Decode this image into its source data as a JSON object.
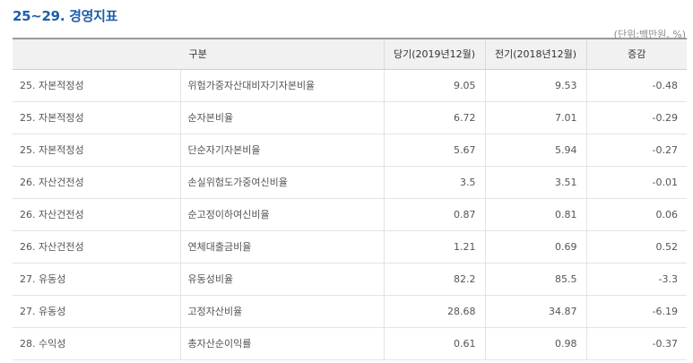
{
  "title": "25~29. 경영지표",
  "unit_note": "(단위:백만원, %)",
  "headers": [
    "구분",
    "당기(2019년12월)",
    "전기(2018년12월)",
    "증감"
  ],
  "rows": [
    {
      "category": "25. 자본적정성",
      "item": "위험가중자산대비자기자본비율",
      "current": "9.05",
      "previous": "9.53",
      "change": "-0.48"
    },
    {
      "category": "25. 자본적정성",
      "item": "순자본비율",
      "current": "6.72",
      "previous": "7.01",
      "change": "-0.29"
    },
    {
      "category": "25. 자본적정성",
      "item": "단순자기자본비율",
      "current": "5.67",
      "previous": "5.94",
      "change": "-0.27"
    },
    {
      "category": "26. 자산건전성",
      "item": "손실위험도가중여신비율",
      "current": "3.5",
      "previous": "3.51",
      "change": "-0.01"
    },
    {
      "category": "26. 자산건전성",
      "item": "순고정이하여신비율",
      "current": "0.87",
      "previous": "0.81",
      "change": "0.06"
    },
    {
      "category": "26. 자산건전성",
      "item": "연체대출금비율",
      "current": "1.21",
      "previous": "0.69",
      "change": "0.52"
    },
    {
      "category": "27. 유동성",
      "item": "유동성비율",
      "current": "82.2",
      "previous": "85.5",
      "change": "-3.3"
    },
    {
      "category": "27. 유동성",
      "item": "고정자산비율",
      "current": "28.68",
      "previous": "34.87",
      "change": "-6.19"
    },
    {
      "category": "28. 수익성",
      "item": "총자산순이익률",
      "current": "0.61",
      "previous": "0.98",
      "change": "-0.37"
    }
  ]
}
